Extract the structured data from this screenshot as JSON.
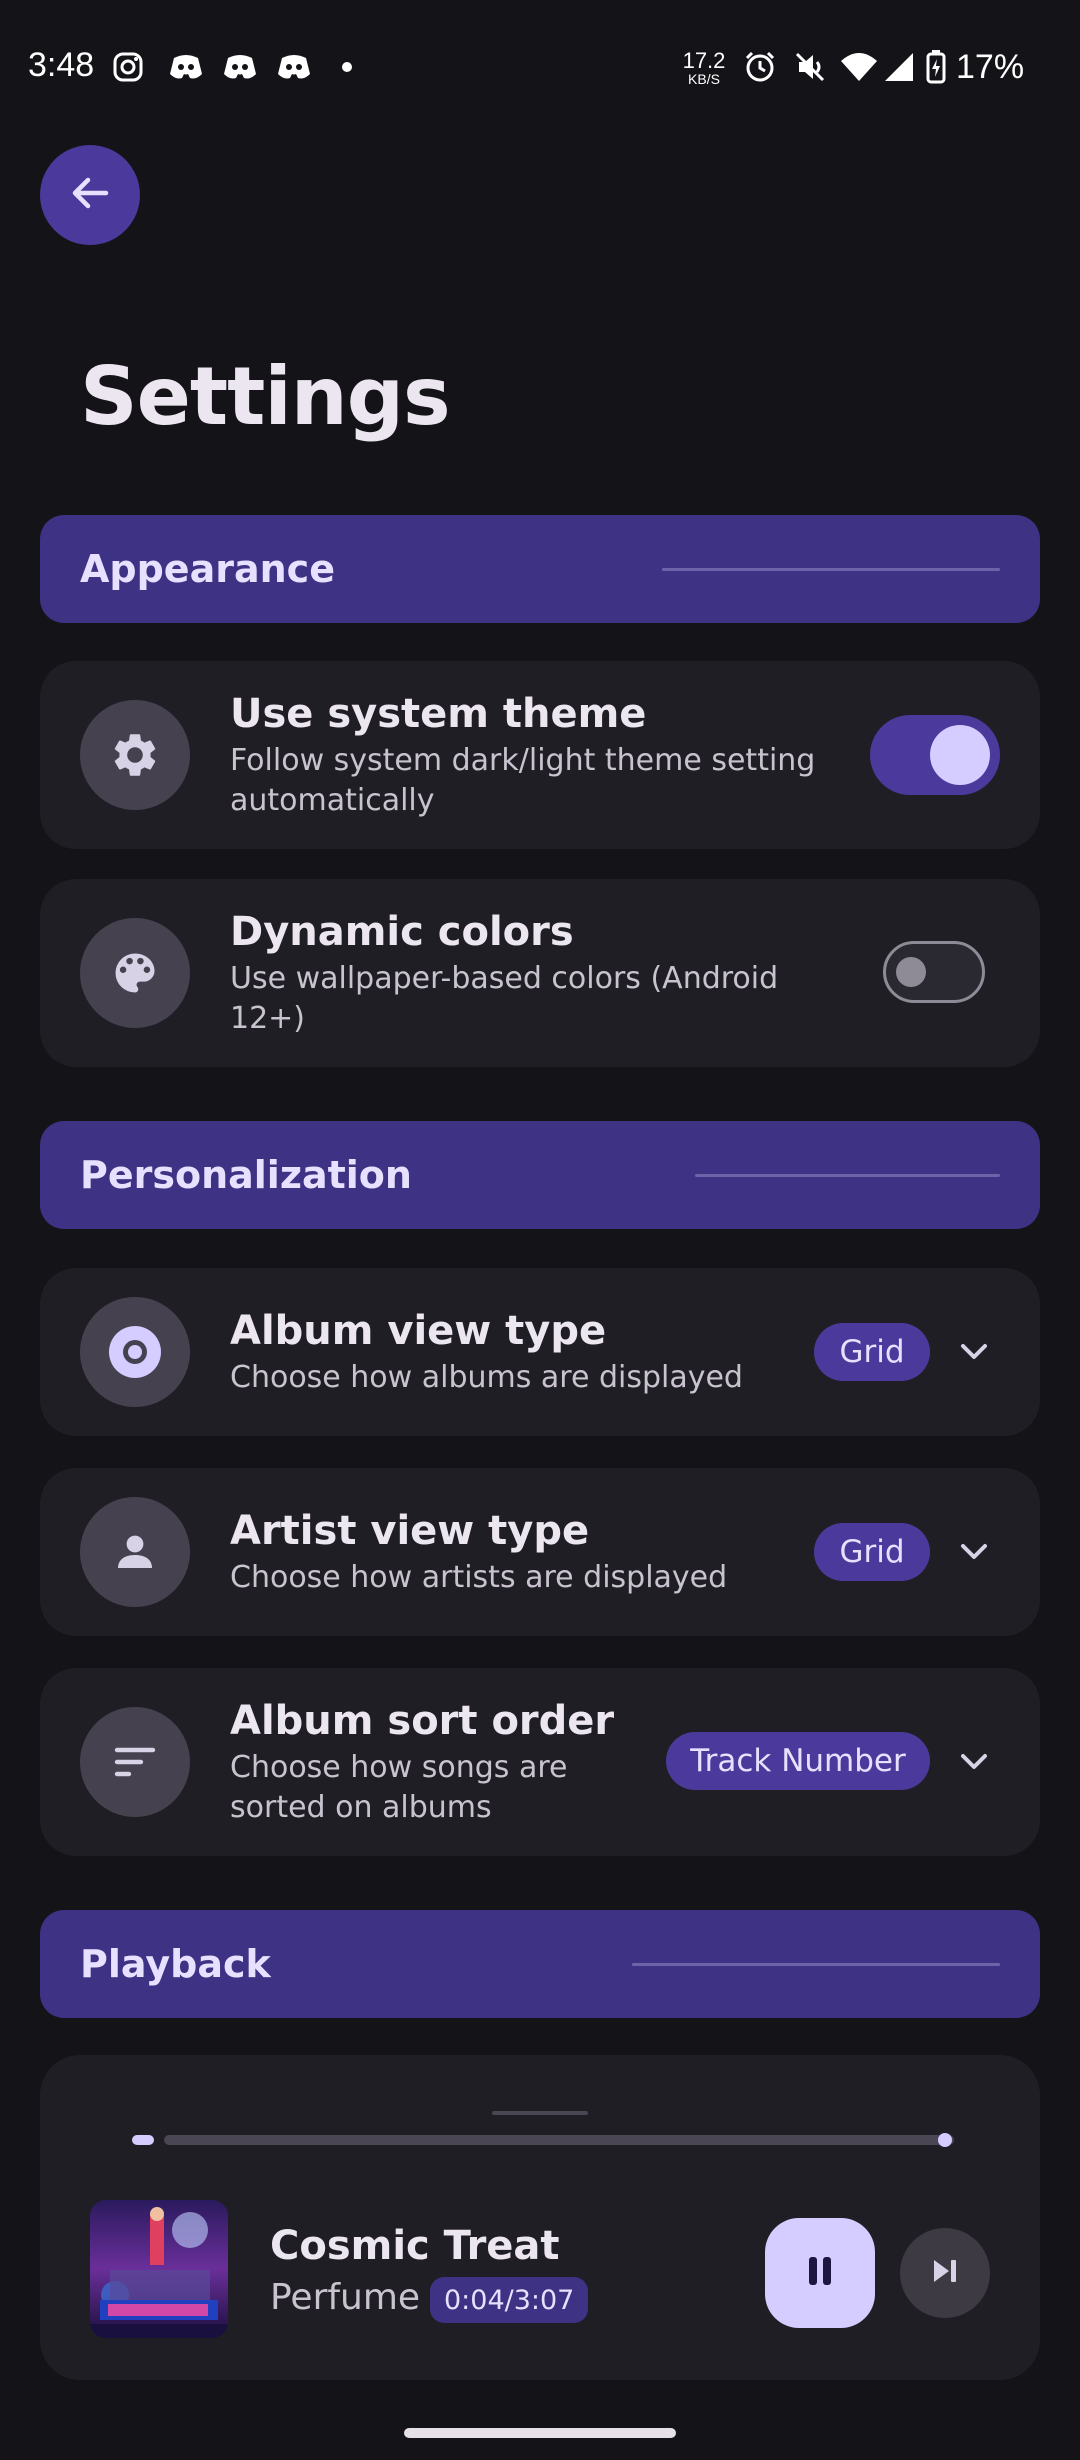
{
  "status_bar": {
    "time": "3:48",
    "net_speed_value": "17.2",
    "net_speed_unit": "KB/S",
    "battery": "17%",
    "left_icons": [
      "instagram-icon",
      "discord-icon",
      "discord-icon",
      "discord-icon",
      "dot-icon"
    ],
    "right_icons": [
      "alarm-icon",
      "mute-icon",
      "wifi-icon",
      "signal-icon",
      "battery-charging-icon"
    ]
  },
  "header": {
    "title": "Settings"
  },
  "sections": {
    "appearance": "Appearance",
    "personalization": "Personalization",
    "playback": "Playback"
  },
  "settings": {
    "system_theme": {
      "title": "Use system theme",
      "subtitle_l1": "Follow system dark/light theme setting",
      "subtitle_l2": "automatically",
      "enabled": true
    },
    "dynamic_colors": {
      "title": "Dynamic colors",
      "subtitle_l1": "Use wallpaper-based colors (Android",
      "subtitle_l2": "12+)",
      "enabled": false
    },
    "album_view": {
      "title": "Album view type",
      "subtitle": "Choose how albums are displayed",
      "value": "Grid"
    },
    "artist_view": {
      "title": "Artist view type",
      "subtitle": "Choose how artists are displayed",
      "value": "Grid"
    },
    "album_sort": {
      "title": "Album sort order",
      "subtitle_l1": "Choose how songs are",
      "subtitle_l2": "sorted on albums",
      "value": "Track Number"
    }
  },
  "player": {
    "song": "Cosmic Treat",
    "artist": "Perfume",
    "time": "0:04/3:07",
    "progress_fraction": 0.013,
    "state": "playing"
  },
  "colors": {
    "background": "#141318",
    "accent": "#4b3a9b",
    "section_bg": "#3d3283",
    "card_bg": "#201e25",
    "accent_light": "#d5ccff"
  }
}
